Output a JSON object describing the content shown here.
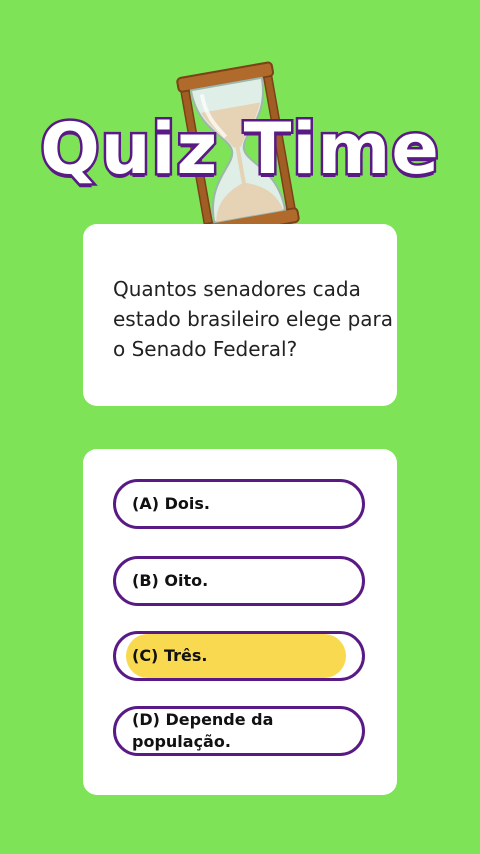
{
  "header": {
    "title": "Quiz Time",
    "icon": "hourglass-icon"
  },
  "question": {
    "text": "Quantos senadores cada estado brasileiro elege para o Senado Federal?"
  },
  "options": [
    {
      "label": "(A) Dois.",
      "highlighted": false
    },
    {
      "label": "(B) Oito.",
      "highlighted": false
    },
    {
      "label": "(C) Três.",
      "highlighted": true
    },
    {
      "label": "(D) Depende da população.",
      "highlighted": false
    }
  ],
  "colors": {
    "background": "#7ee356",
    "accent": "#5a1a86",
    "highlight": "#f9d94f",
    "card": "#ffffff"
  }
}
